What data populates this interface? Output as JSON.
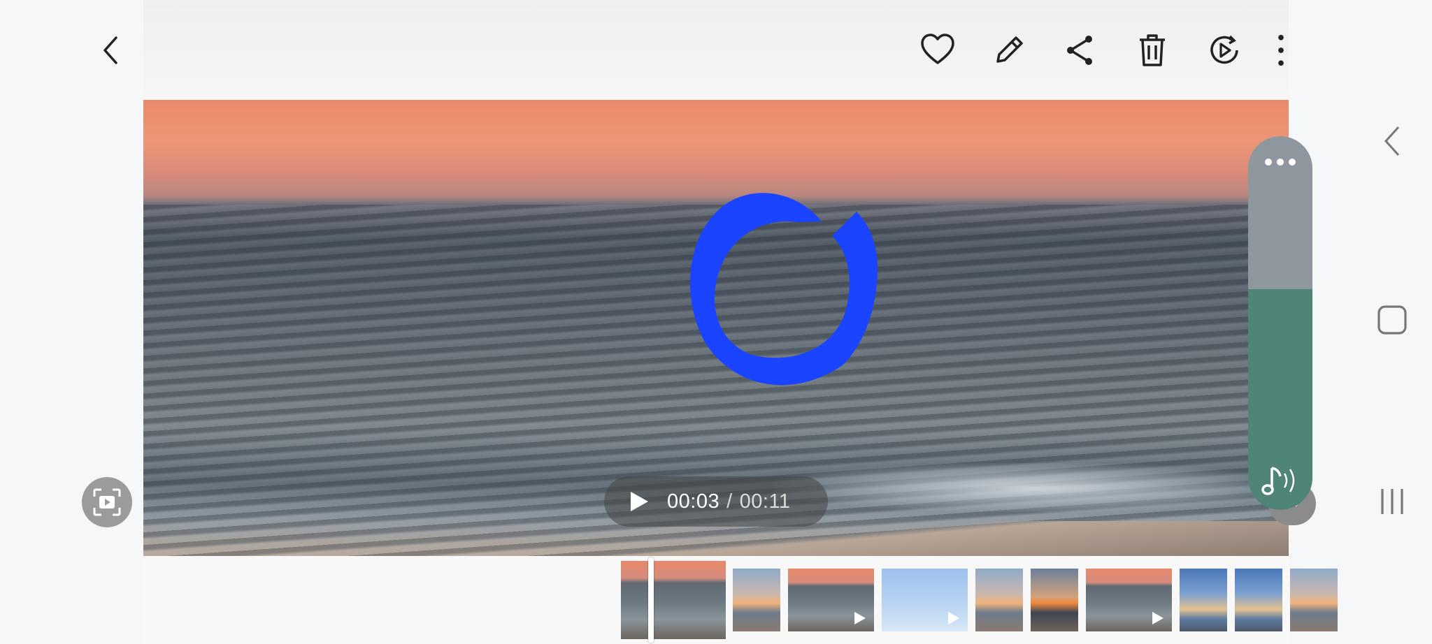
{
  "toolbar": {
    "back": "back-arrow-icon",
    "actions": [
      "heart-icon",
      "pencil-icon",
      "share-icon",
      "trash-icon",
      "motion-play-icon",
      "more-vert-icon"
    ]
  },
  "player": {
    "current_time": "00:03",
    "separator": "/",
    "total_time": "00:11",
    "progress": 0.27
  },
  "audio_panel": {
    "level": 0.59,
    "colors": {
      "track": "#8e979d",
      "fill": "#4f8577"
    }
  },
  "loader_color": "#1a44ff",
  "filmstrip": {
    "thumbnails": [
      {
        "kind": "video",
        "selected": true,
        "palette": "sunset-waves"
      },
      {
        "kind": "image",
        "palette": "dusk-clouds"
      },
      {
        "kind": "video",
        "palette": "sunset-waves"
      },
      {
        "kind": "video",
        "palette": "selfie-sky"
      },
      {
        "kind": "image",
        "palette": "dusk-clouds"
      },
      {
        "kind": "image",
        "palette": "sunset-beach"
      },
      {
        "kind": "video",
        "palette": "sunset-waves"
      },
      {
        "kind": "image",
        "palette": "blue-clouds"
      },
      {
        "kind": "image",
        "palette": "blue-clouds"
      },
      {
        "kind": "image",
        "palette": "dusk-clouds"
      }
    ]
  },
  "system_nav": [
    "back-chevron-icon",
    "home-square-icon",
    "recents-icon"
  ]
}
